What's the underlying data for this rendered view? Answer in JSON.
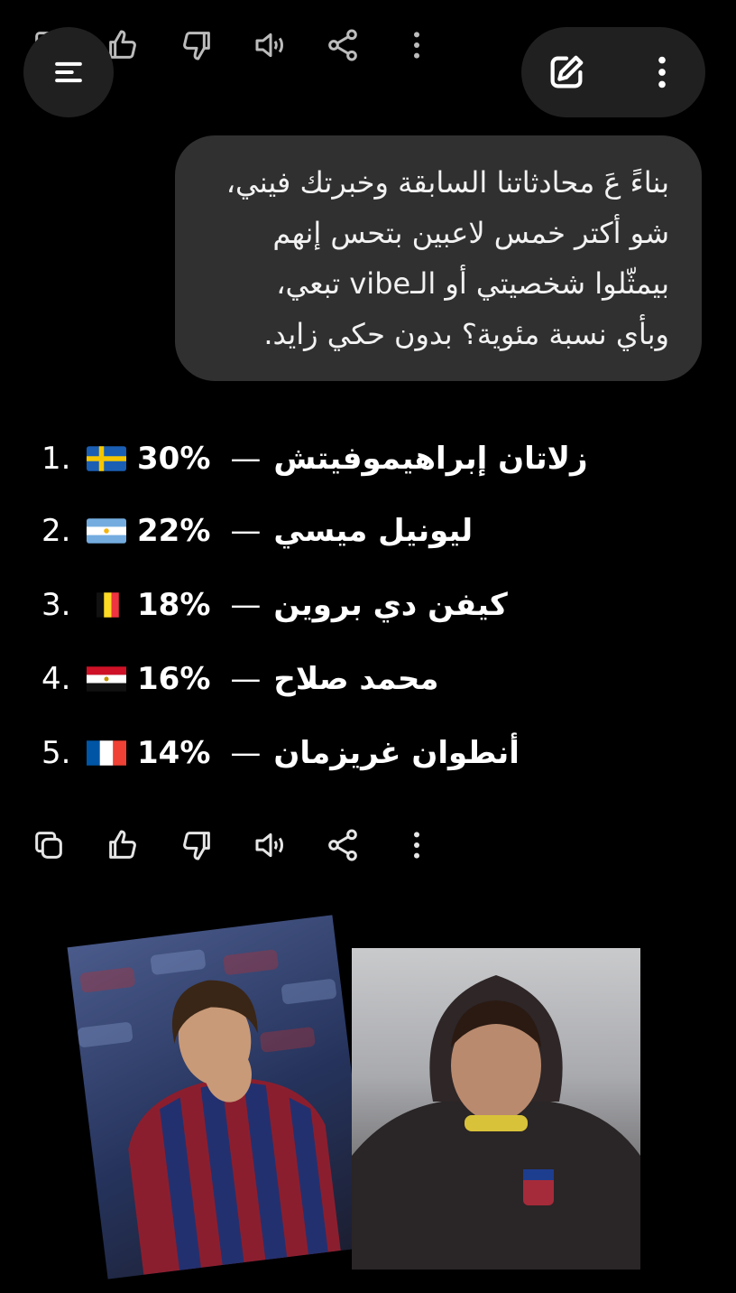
{
  "user_message": {
    "lines": [
      "بناءً عَ محادثاتنا السابقة وخبرتك فيني،",
      "شو أكتر خمس لاعبين بتحس إنهم",
      "بيمثّلوا شخصيتي أو الـvibe تبعي،",
      "وبأي نسبة مئوية؟ بدون حكي زايد."
    ]
  },
  "answer": {
    "items": [
      {
        "number": "1.",
        "percent": "30%",
        "name": "زلاتان إبراهيموفيتش",
        "flag": "sweden-flag",
        "separator": "—"
      },
      {
        "number": "2.",
        "percent": "22%",
        "name": "ليونيل ميسي",
        "flag": "argentina-flag",
        "separator": "—"
      },
      {
        "number": "3.",
        "percent": "18%",
        "name": "كيفن دي بروين",
        "flag": "belgium-flag",
        "separator": "—"
      },
      {
        "number": "4.",
        "percent": "16%",
        "name": "محمد صلاح",
        "flag": "egypt-flag",
        "separator": "—"
      },
      {
        "number": "5.",
        "percent": "14%",
        "name": "أنطوان غريزمان",
        "flag": "france-flag",
        "separator": "—"
      }
    ]
  },
  "icons": {
    "menu": "menu-icon",
    "edit": "edit-icon",
    "more": "more-vertical-icon",
    "copy": "copy-icon",
    "like": "thumbs-up-icon",
    "dislike": "thumbs-down-icon",
    "read_aloud": "speaker-icon",
    "share": "share-icon"
  },
  "images": [
    {
      "name": "zlatan-photo",
      "kind": "player-photo"
    },
    {
      "name": "messi-photo",
      "kind": "player-photo"
    }
  ],
  "colors": {
    "background": "#000000",
    "bubble": "#303030",
    "pill": "#202020",
    "text": "#ffffff"
  }
}
